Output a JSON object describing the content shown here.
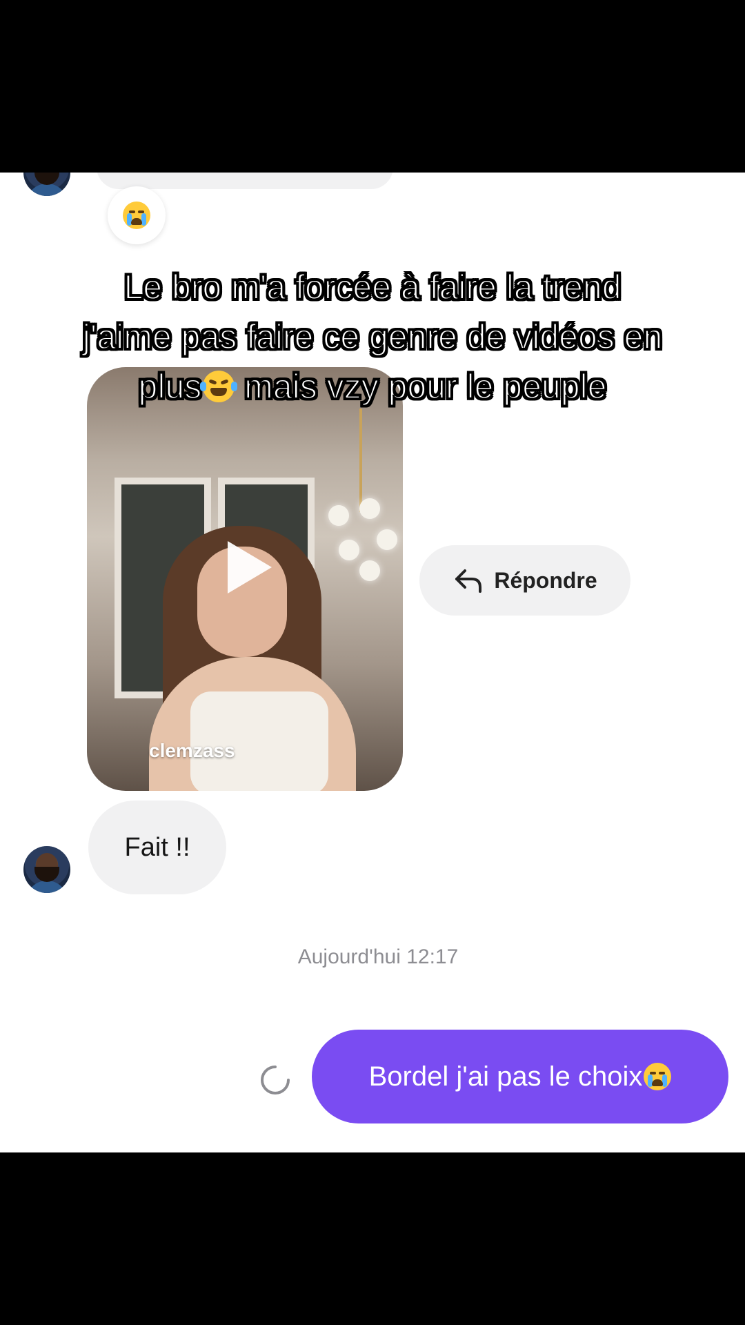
{
  "overlay": {
    "line1": "Le bro m'a forcée à faire la trend",
    "line2": "j'aime pas faire ce genre de vidéos en",
    "line3_a": "plus",
    "line3_b": " mais vzy pour le peuple"
  },
  "messages": {
    "video_username": "clemzass",
    "reply_label": "Répondre",
    "incoming_text": "Fait !!",
    "timestamp": "Aujourd'hui 12:17",
    "outgoing_text": "Bordel j'ai pas le choix"
  },
  "icons": {
    "reaction": "loudly-crying-face-emoji",
    "reply": "reply-arrow-icon",
    "play": "play-icon",
    "sending": "sending-spinner-icon"
  },
  "colors": {
    "outgoing_bubble": "#7a4cf2",
    "incoming_bubble": "#f1f1f2",
    "timestamp": "#8d8d92"
  }
}
